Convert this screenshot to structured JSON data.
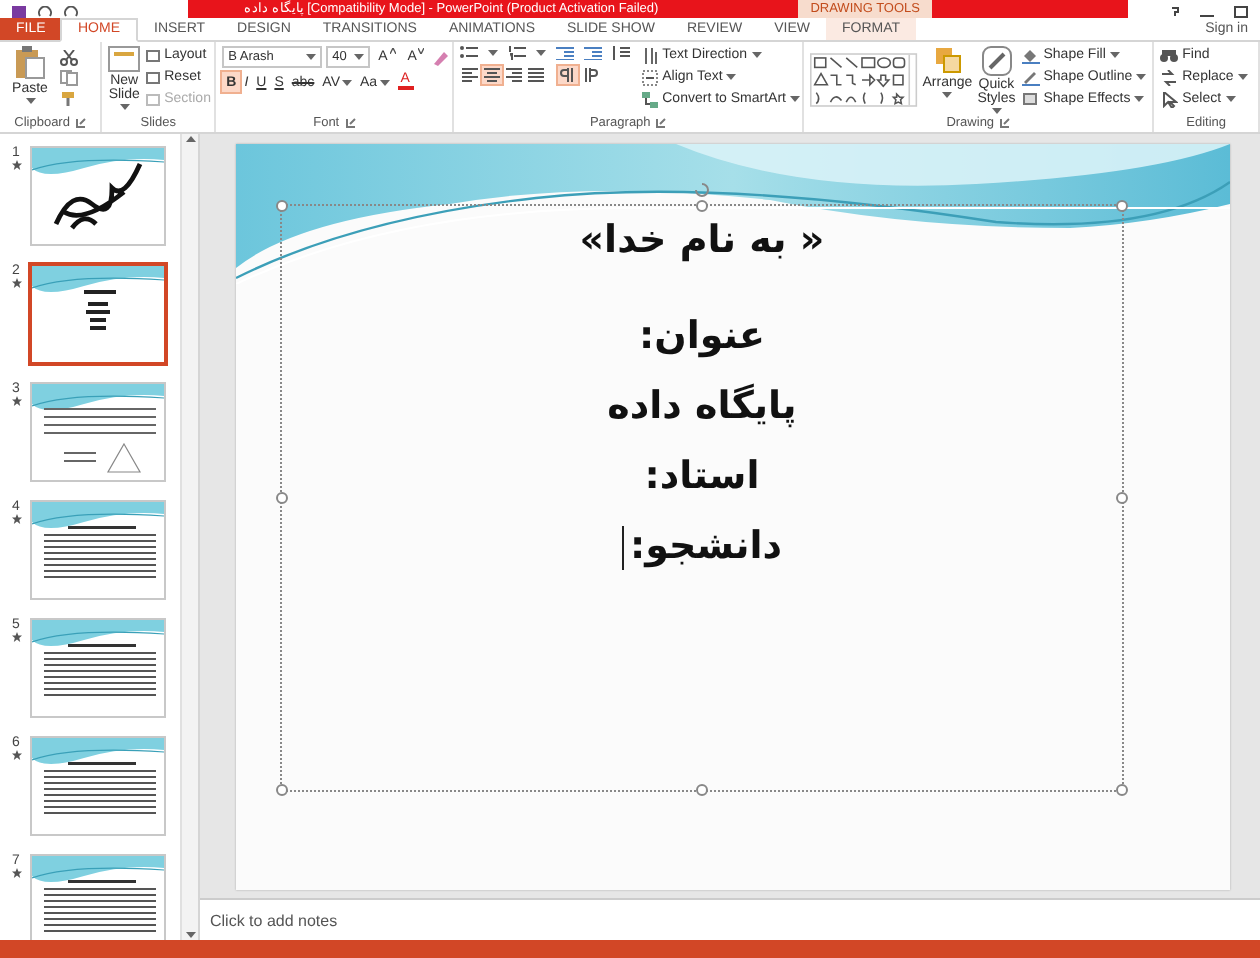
{
  "title_bar": {
    "title": "پایگاه داده [Compatibility Mode] - PowerPoint (Product Activation Failed)",
    "contextual_label": "DRAWING TOOLS"
  },
  "tabs": [
    {
      "label": "FILE",
      "kind": "file",
      "selected": false
    },
    {
      "label": "HOME",
      "kind": "tab",
      "selected": true
    },
    {
      "label": "INSERT",
      "kind": "tab",
      "selected": false
    },
    {
      "label": "DESIGN",
      "kind": "tab",
      "selected": false
    },
    {
      "label": "TRANSITIONS",
      "kind": "tab",
      "selected": false
    },
    {
      "label": "ANIMATIONS",
      "kind": "tab",
      "selected": false
    },
    {
      "label": "SLIDE SHOW",
      "kind": "tab",
      "selected": false
    },
    {
      "label": "REVIEW",
      "kind": "tab",
      "selected": false
    },
    {
      "label": "VIEW",
      "kind": "tab",
      "selected": false
    },
    {
      "label": "FORMAT",
      "kind": "contextual",
      "selected": false
    }
  ],
  "sign_in": "Sign in",
  "clipboard": {
    "label": "Clipboard",
    "paste": "Paste"
  },
  "slides": {
    "label": "Slides",
    "new_slide": "New Slide",
    "commands": [
      {
        "label": "Layout",
        "disabled": false
      },
      {
        "label": "Reset",
        "disabled": false
      },
      {
        "label": "Section",
        "disabled": true
      }
    ]
  },
  "font": {
    "label": "Font",
    "font_name": "B Arash",
    "font_size": "40",
    "size_buttons": [
      {
        "label": "A",
        "kind": "grow"
      },
      {
        "label": "A",
        "kind": "shrink"
      }
    ],
    "format_buttons": [
      {
        "label": "B",
        "kind": "toggle",
        "selected": true
      },
      {
        "label": "I",
        "kind": "toggle",
        "selected": false
      },
      {
        "label": "U",
        "kind": "toggle",
        "selected": false
      },
      {
        "label": "S",
        "kind": "toggle",
        "selected": false
      },
      {
        "label": "abc",
        "kind": "toggle",
        "selected": false
      },
      {
        "label": "AV",
        "kind": "dropdown",
        "selected": false
      },
      {
        "label": "Aa",
        "kind": "dropdown",
        "selected": false
      },
      {
        "label": "A",
        "kind": "color",
        "selected": false
      }
    ]
  },
  "paragraph": {
    "label": "Paragraph",
    "alignment": [
      {
        "kind": "left",
        "selected": false
      },
      {
        "kind": "center",
        "selected": true
      },
      {
        "kind": "right",
        "selected": false
      },
      {
        "kind": "justify",
        "selected": false
      }
    ],
    "direction": [
      {
        "kind": "rtl",
        "selected": true
      },
      {
        "kind": "ltr",
        "selected": false
      }
    ],
    "commands": [
      "Text Direction",
      "Align Text",
      "Convert to SmartArt"
    ]
  },
  "drawing": {
    "label": "Drawing",
    "arrange": "Arrange",
    "quick_styles": "Quick Styles",
    "commands": [
      "Shape Fill",
      "Shape Outline",
      "Shape Effects"
    ]
  },
  "editing": {
    "label": "Editing",
    "commands": [
      "Find",
      "Replace",
      "Select"
    ]
  },
  "thumbnails": [
    {
      "number": "1",
      "kind": "calligraphy",
      "selected": false,
      "animated": true
    },
    {
      "number": "2",
      "kind": "title",
      "selected": true,
      "animated": true
    },
    {
      "number": "3",
      "kind": "diagram",
      "selected": false,
      "animated": true
    },
    {
      "number": "4",
      "kind": "text",
      "selected": false,
      "animated": true
    },
    {
      "number": "5",
      "kind": "text",
      "selected": false,
      "animated": true
    },
    {
      "number": "6",
      "kind": "text",
      "selected": false,
      "animated": true
    },
    {
      "number": "7",
      "kind": "text",
      "selected": false,
      "animated": true
    }
  ],
  "slide": {
    "lines": [
      "« به نام خدا»",
      "عنوان:",
      "پایگاه داده",
      "استاد:",
      "دانشجو:"
    ]
  },
  "notes": {
    "placeholder": "Click to add notes"
  }
}
